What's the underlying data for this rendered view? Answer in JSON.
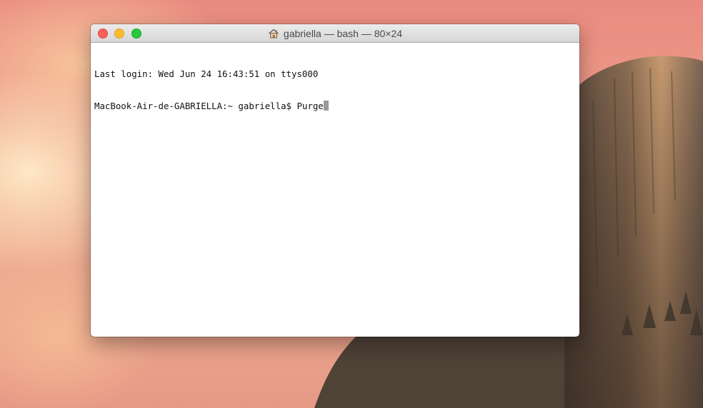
{
  "window": {
    "title": "gabriella — bash — 80×24",
    "title_icon": "home-icon",
    "traffic_lights": {
      "close_color": "#fc5f57",
      "minimize_color": "#fdbc2e",
      "zoom_color": "#28c840"
    }
  },
  "terminal": {
    "lines": [
      "Last login: Wed Jun 24 16:43:51 on ttys000",
      "MacBook-Air-de-GABRIELLA:~ gabriella$ Purge"
    ],
    "background": "#ffffff",
    "text_color": "#111111",
    "cursor_color": "#9a9a9a"
  },
  "desktop": {
    "wallpaper": "Yosemite El Capitan sunset"
  }
}
